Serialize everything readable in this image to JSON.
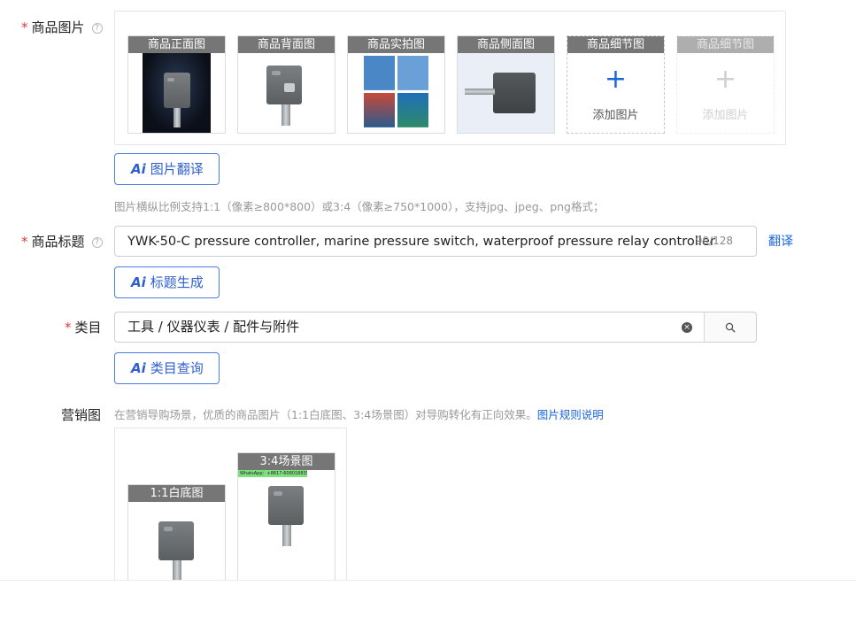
{
  "product_images": {
    "label": "商品图片",
    "required_mark": "*",
    "help_icon": "question-circle-icon",
    "slots": [
      {
        "caption": "商品正面图",
        "type": "image",
        "state": "filled"
      },
      {
        "caption": "商品背面图",
        "type": "image",
        "state": "filled"
      },
      {
        "caption": "商品实拍图",
        "type": "image",
        "state": "filled"
      },
      {
        "caption": "商品侧面图",
        "type": "image",
        "state": "filled"
      },
      {
        "caption": "商品细节图",
        "type": "add",
        "state": "active",
        "add_label": "添加图片"
      },
      {
        "caption": "商品细节图",
        "type": "add",
        "state": "disabled",
        "add_label": "添加图片"
      }
    ],
    "ai_button": {
      "ai": "Ai",
      "label": "图片翻译"
    },
    "hint": "图片横纵比例支持1:1（像素≥800*800）或3:4（像素≥750*1000），支持jpg、jpeg、png格式；"
  },
  "title_field": {
    "label": "商品标题",
    "required_mark": "*",
    "value": "YWK-50-C pressure controller, marine pressure switch, waterproof pressure relay controller",
    "count": "90/128",
    "translate_link": "翻译",
    "ai_button": {
      "ai": "Ai",
      "label": "标题生成"
    }
  },
  "category_field": {
    "label": "类目",
    "required_mark": "*",
    "value": "工具 / 仪器仪表 / 配件与附件",
    "clear_icon": "clear-circle-icon",
    "search_icon": "search-icon",
    "ai_button": {
      "ai": "Ai",
      "label": "类目查询"
    }
  },
  "marketing": {
    "label": "营销图",
    "hint": "在营销导购场景，优质的商品图片（1:1白底图、3:4场景图）对导购转化有正向效果。",
    "rules_link": "图片规则说明",
    "slots": [
      {
        "caption": "1:1白底图"
      },
      {
        "caption": "3:4场景图",
        "overlay_text": "WhatsApp：+8617-608018835"
      }
    ]
  },
  "colors": {
    "accent": "#1a66d9",
    "required": "#e4393c",
    "hint": "#999999"
  }
}
